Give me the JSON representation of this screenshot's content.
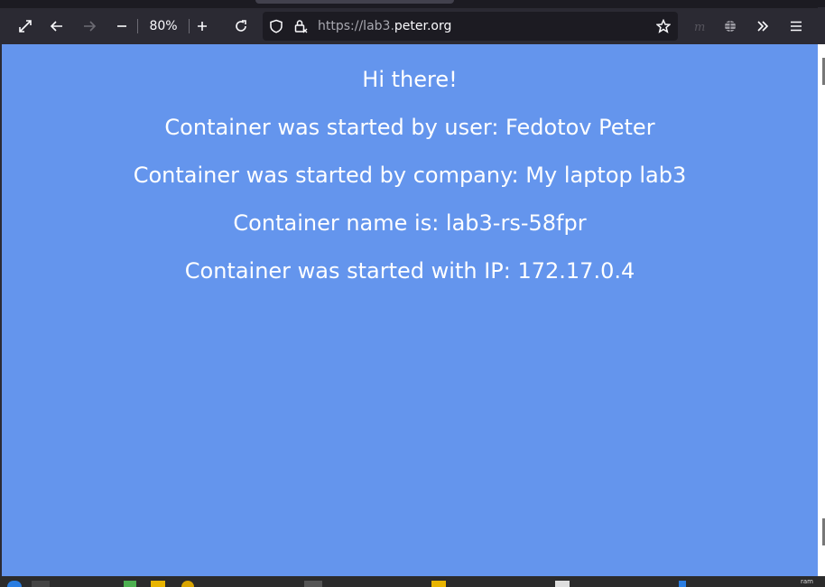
{
  "browser": {
    "zoom_level": "80%",
    "url_prefix": "https://lab3.",
    "url_domain": "peter.org"
  },
  "page": {
    "lines": [
      "Hi there!",
      "Container was started by user: Fedotov Peter",
      "Container was started by company: My laptop lab3",
      "Container name is: lab3-rs-58fpr",
      "Container was started with IP: 172.17.0.4"
    ],
    "background_color": "#6495ed"
  },
  "taskbar": {
    "ram_label": "ram"
  },
  "icons": [
    "fullscreen-icon",
    "back-icon",
    "forward-icon",
    "zoom-out-icon",
    "zoom-in-icon",
    "reload-icon",
    "shield-icon",
    "lock-icon",
    "bookmark-star-icon",
    "extension-icon",
    "globe-icon",
    "overflow-icon",
    "menu-icon"
  ]
}
